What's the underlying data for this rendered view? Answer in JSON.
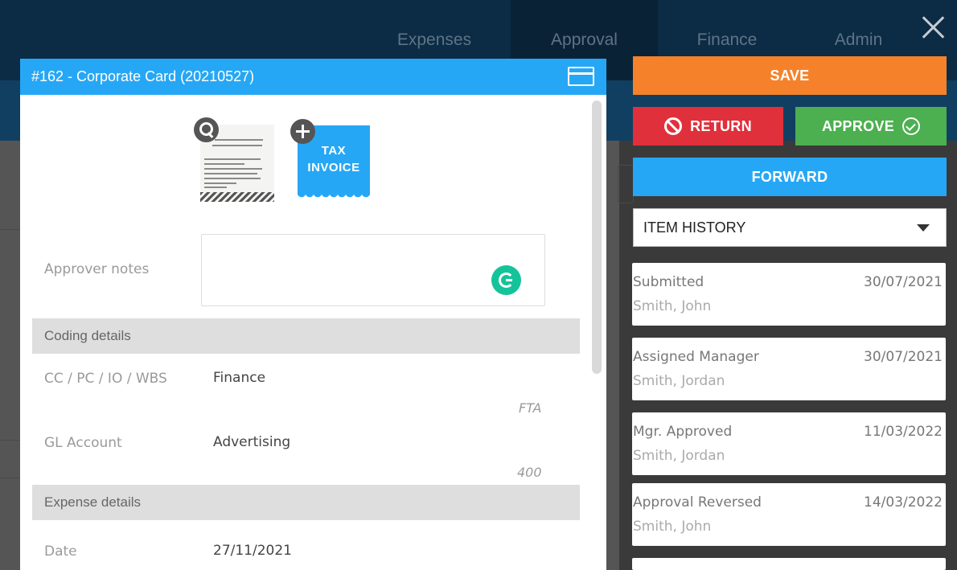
{
  "nav": {
    "items": [
      "Expenses",
      "Approval",
      "Finance",
      "Admin"
    ]
  },
  "modal": {
    "title": "#162 - Corporate Card (20210527)",
    "tax_invoice_label": "TAX\nINVOICE",
    "fields": {
      "approver_notes_label": "Approver notes",
      "approver_notes_value": ""
    },
    "coding": {
      "section_title": "Coding details",
      "cost_center_label": "CC / PC / IO / WBS",
      "cost_center_value": "Finance",
      "cost_center_code": "FTA",
      "gl_label": "GL Account",
      "gl_value": "Advertising",
      "gl_code": "400"
    },
    "expense": {
      "section_title": "Expense details",
      "date_label": "Date",
      "date_value": "27/11/2021"
    }
  },
  "actions": {
    "save": "SAVE",
    "return": "RETURN",
    "approve": "APPROVE",
    "forward": "FORWARD",
    "history_select": "ITEM HISTORY"
  },
  "history": [
    {
      "event": "Submitted",
      "date": "30/07/2021",
      "who": "Smith, John"
    },
    {
      "event": "Assigned Manager",
      "date": "30/07/2021",
      "who": "Smith, Jordan"
    },
    {
      "event": "Mgr. Approved",
      "date": "11/03/2022",
      "who": "Smith, Jordan"
    },
    {
      "event": "Approval Reversed",
      "date": "14/03/2022",
      "who": "Smith, John"
    }
  ],
  "colors": {
    "primary": "#26a7f5",
    "save": "#f5822a",
    "return": "#e0303b",
    "approve": "#4caf50"
  }
}
